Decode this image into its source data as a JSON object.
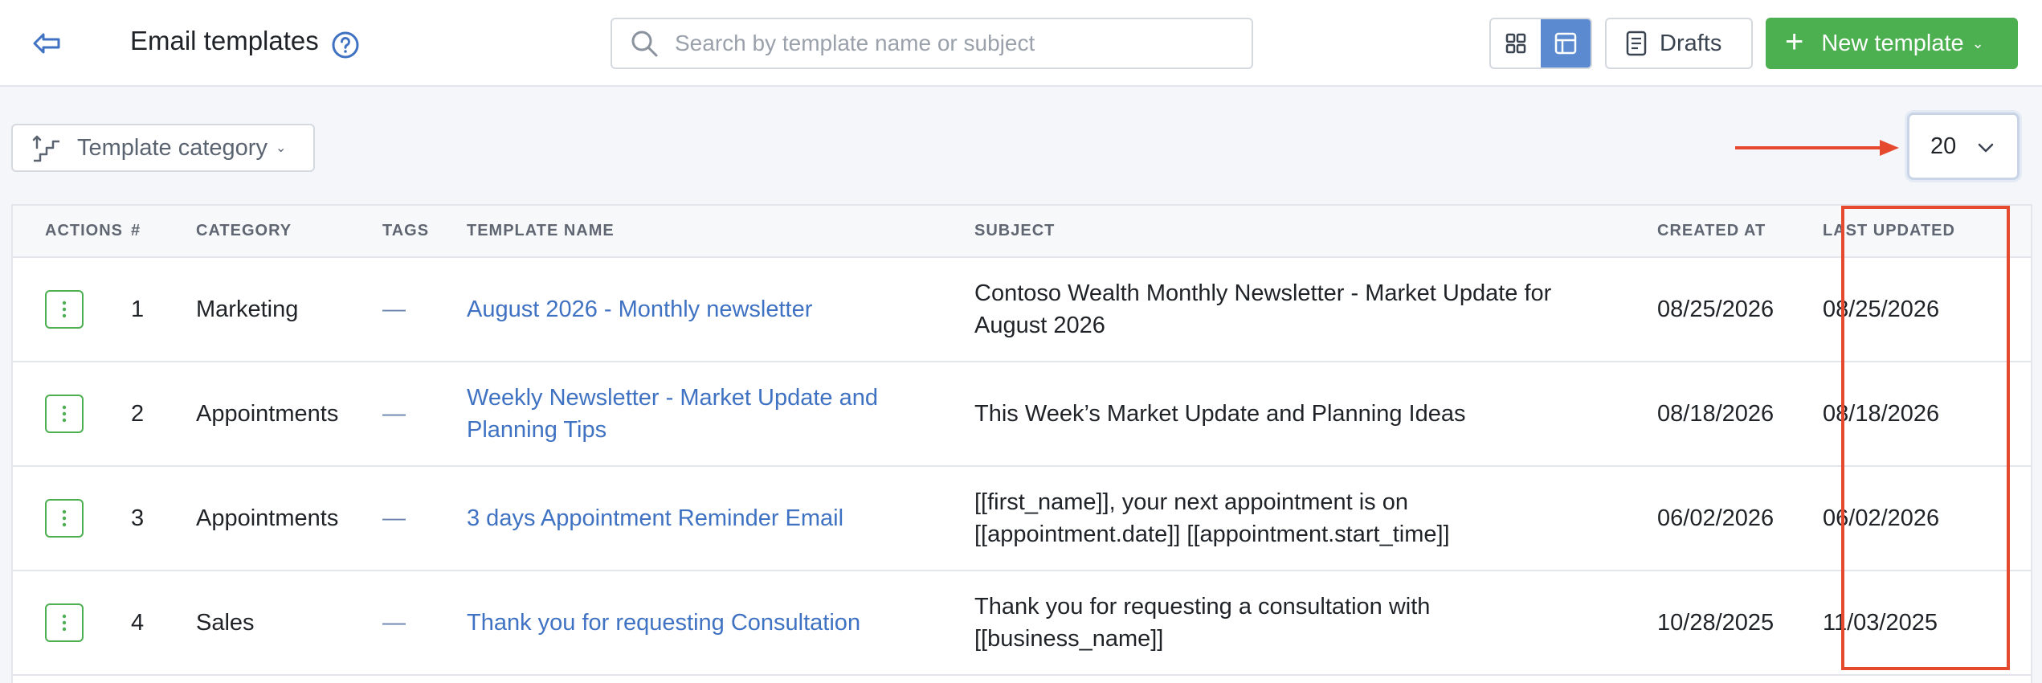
{
  "header": {
    "title": "Email templates",
    "search_placeholder": "Search by template name or subject",
    "drafts_label": "Drafts",
    "new_template_label": "New template"
  },
  "filters": {
    "category_label": "Template category",
    "page_size": "20"
  },
  "table": {
    "columns": [
      "ACTIONS",
      "#",
      "CATEGORY",
      "TAGS",
      "TEMPLATE NAME",
      "SUBJECT",
      "CREATED AT",
      "LAST UPDATED"
    ],
    "rows": [
      {
        "num": "1",
        "category": "Marketing",
        "tags": "—",
        "name": "August 2026 - Monthly newsletter",
        "subject": "Contoso Wealth Monthly Newsletter - Market Update for August 2026",
        "created": "08/25/2026",
        "updated": "08/25/2026"
      },
      {
        "num": "2",
        "category": "Appointments",
        "tags": "—",
        "name": "Weekly Newsletter - Market Update and Planning Tips",
        "subject": "This Week’s Market Update and Planning Ideas",
        "created": "08/18/2026",
        "updated": "08/18/2026"
      },
      {
        "num": "3",
        "category": "Appointments",
        "tags": "—",
        "name": "3 days Appointment Reminder Email",
        "subject": "[[first_name]], your next appointment is on [[appointment.date]] [[appointment.start_time]]",
        "created": "06/02/2026",
        "updated": "06/02/2026"
      },
      {
        "num": "4",
        "category": "Sales",
        "tags": "—",
        "name": "Thank you for requesting Consultation",
        "subject": "Thank you for requesting a consultation with [[business_name]]",
        "created": "10/28/2025",
        "updated": "11/03/2025"
      }
    ]
  },
  "colors": {
    "accent_green": "#4caf50",
    "link_blue": "#3f72c2",
    "highlight_red": "#e64a2e",
    "toggle_active": "#5b8ad0"
  },
  "icons": [
    "back-icon",
    "help-icon",
    "search-icon",
    "grid-view-icon",
    "table-view-icon",
    "document-icon",
    "plus-icon",
    "stairs-icon",
    "chevron-down-icon",
    "kebab-icon"
  ]
}
